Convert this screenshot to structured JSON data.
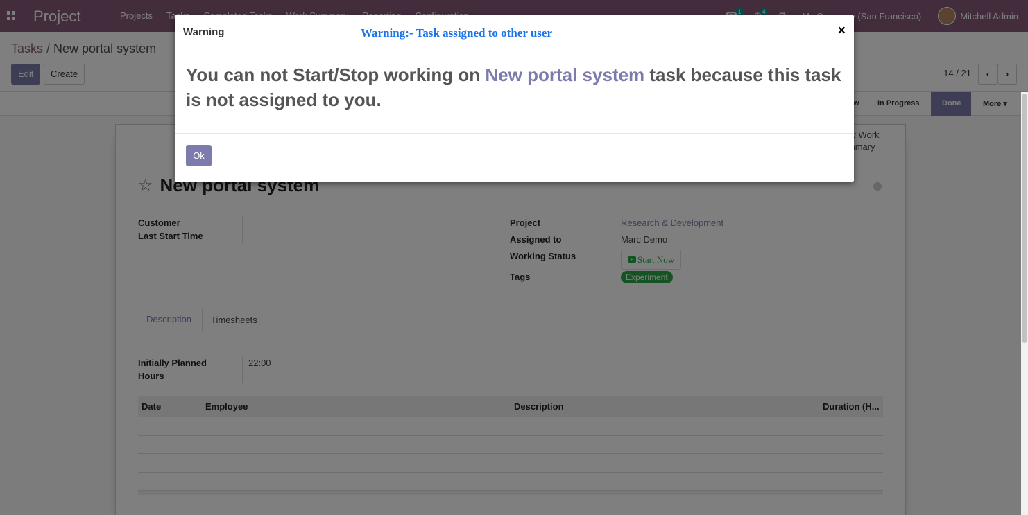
{
  "navbar": {
    "app_name": "Project",
    "menu": [
      "Projects",
      "Tasks",
      "Completed Tasks",
      "Work Summary",
      "Reporting",
      "Configuration"
    ],
    "chat_count": "1",
    "activity_count": "4",
    "company": "My Company (San Francisco)",
    "user": "Mitchell Admin"
  },
  "control": {
    "breadcrumb_parent": "Tasks",
    "breadcrumb_separator": "/",
    "breadcrumb_current": "New portal system",
    "edit_label": "Edit",
    "create_label": "Create",
    "pager": "14 / 21"
  },
  "statusbar": {
    "stages": [
      "New",
      "In Progress",
      "Done"
    ],
    "active_stage": "Done",
    "more_label": "More"
  },
  "sheet": {
    "stat_button": "View Work Summary",
    "title": "New portal system",
    "left_fields": [
      {
        "label": "Customer",
        "value": ""
      },
      {
        "label": "Last Start Time",
        "value": ""
      }
    ],
    "project_label": "Project",
    "project_value": "Research & Development",
    "assigned_label": "Assigned to",
    "assigned_value": "Marc Demo",
    "working_status_label": "Working Status",
    "start_now_label": "Start Now",
    "tags_label": "Tags",
    "tag_value": "Experiment",
    "tabs": [
      "Description",
      "Timesheets"
    ],
    "active_tab": "Timesheets",
    "planned_label_line1": "Initially Planned",
    "planned_label_line2": "Hours",
    "planned_value": "22:00",
    "table_headers": [
      "Date",
      "Employee",
      "Description",
      "Duration (H..."
    ]
  },
  "modal": {
    "title": "Warning",
    "subtitle": "Warning:- Task assigned to other user",
    "close_symbol": "×",
    "message_before": "You can not Start/Stop working on ",
    "message_task": "New portal system",
    "message_after": " task because this task is not assigned to you.",
    "ok_label": "Ok"
  },
  "colors": {
    "navbar": "#875a7b",
    "primary": "#7c7bad",
    "success": "#28a745",
    "subtitle_blue": "#1a73e8"
  }
}
